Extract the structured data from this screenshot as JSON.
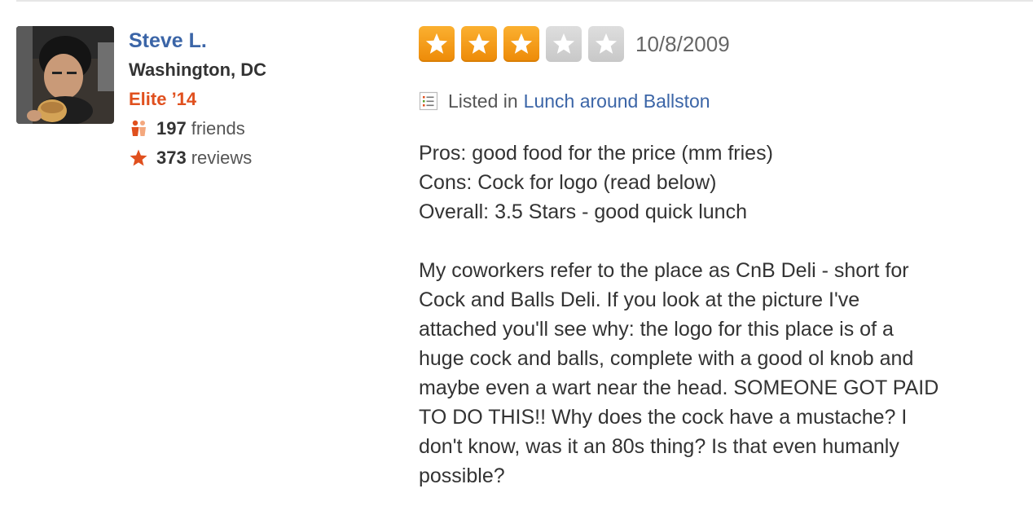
{
  "user": {
    "name": "Steve L.",
    "location": "Washington, DC",
    "elite_badge": "Elite ’14",
    "friends_count": "197",
    "friends_label": "friends",
    "reviews_count": "373",
    "reviews_label": "reviews"
  },
  "review": {
    "rating": 3,
    "max_rating": 5,
    "date": "10/8/2009",
    "listed_prefix": "Listed in",
    "listed_link": "Lunch around Ballston",
    "pros": "Pros: good food for the price (mm fries)",
    "cons": "Cons: Cock for logo (read below)",
    "overall": "Overall: 3.5 Stars - good quick lunch",
    "body_lines": [
      "My coworkers refer to the place as CnB Deli - short for",
      "Cock and Balls Deli. If you look at the picture I've",
      "attached you'll see why: the logo for this place is of a",
      "huge cock and balls, complete with a good ol knob and",
      "maybe even a wart near the head. SOMEONE GOT PAID",
      "TO DO THIS!! Why does the cock have a mustache? I",
      "don't know, was it an 80s thing? Is that even humanly",
      "possible?"
    ]
  },
  "icons": {
    "friends": "friends-icon",
    "reviews": "star-icon",
    "list": "list-icon"
  },
  "colors": {
    "link": "#3b65a7",
    "elite": "#e0501e",
    "star_on": "#f39c12",
    "star_off": "#cccccc"
  }
}
